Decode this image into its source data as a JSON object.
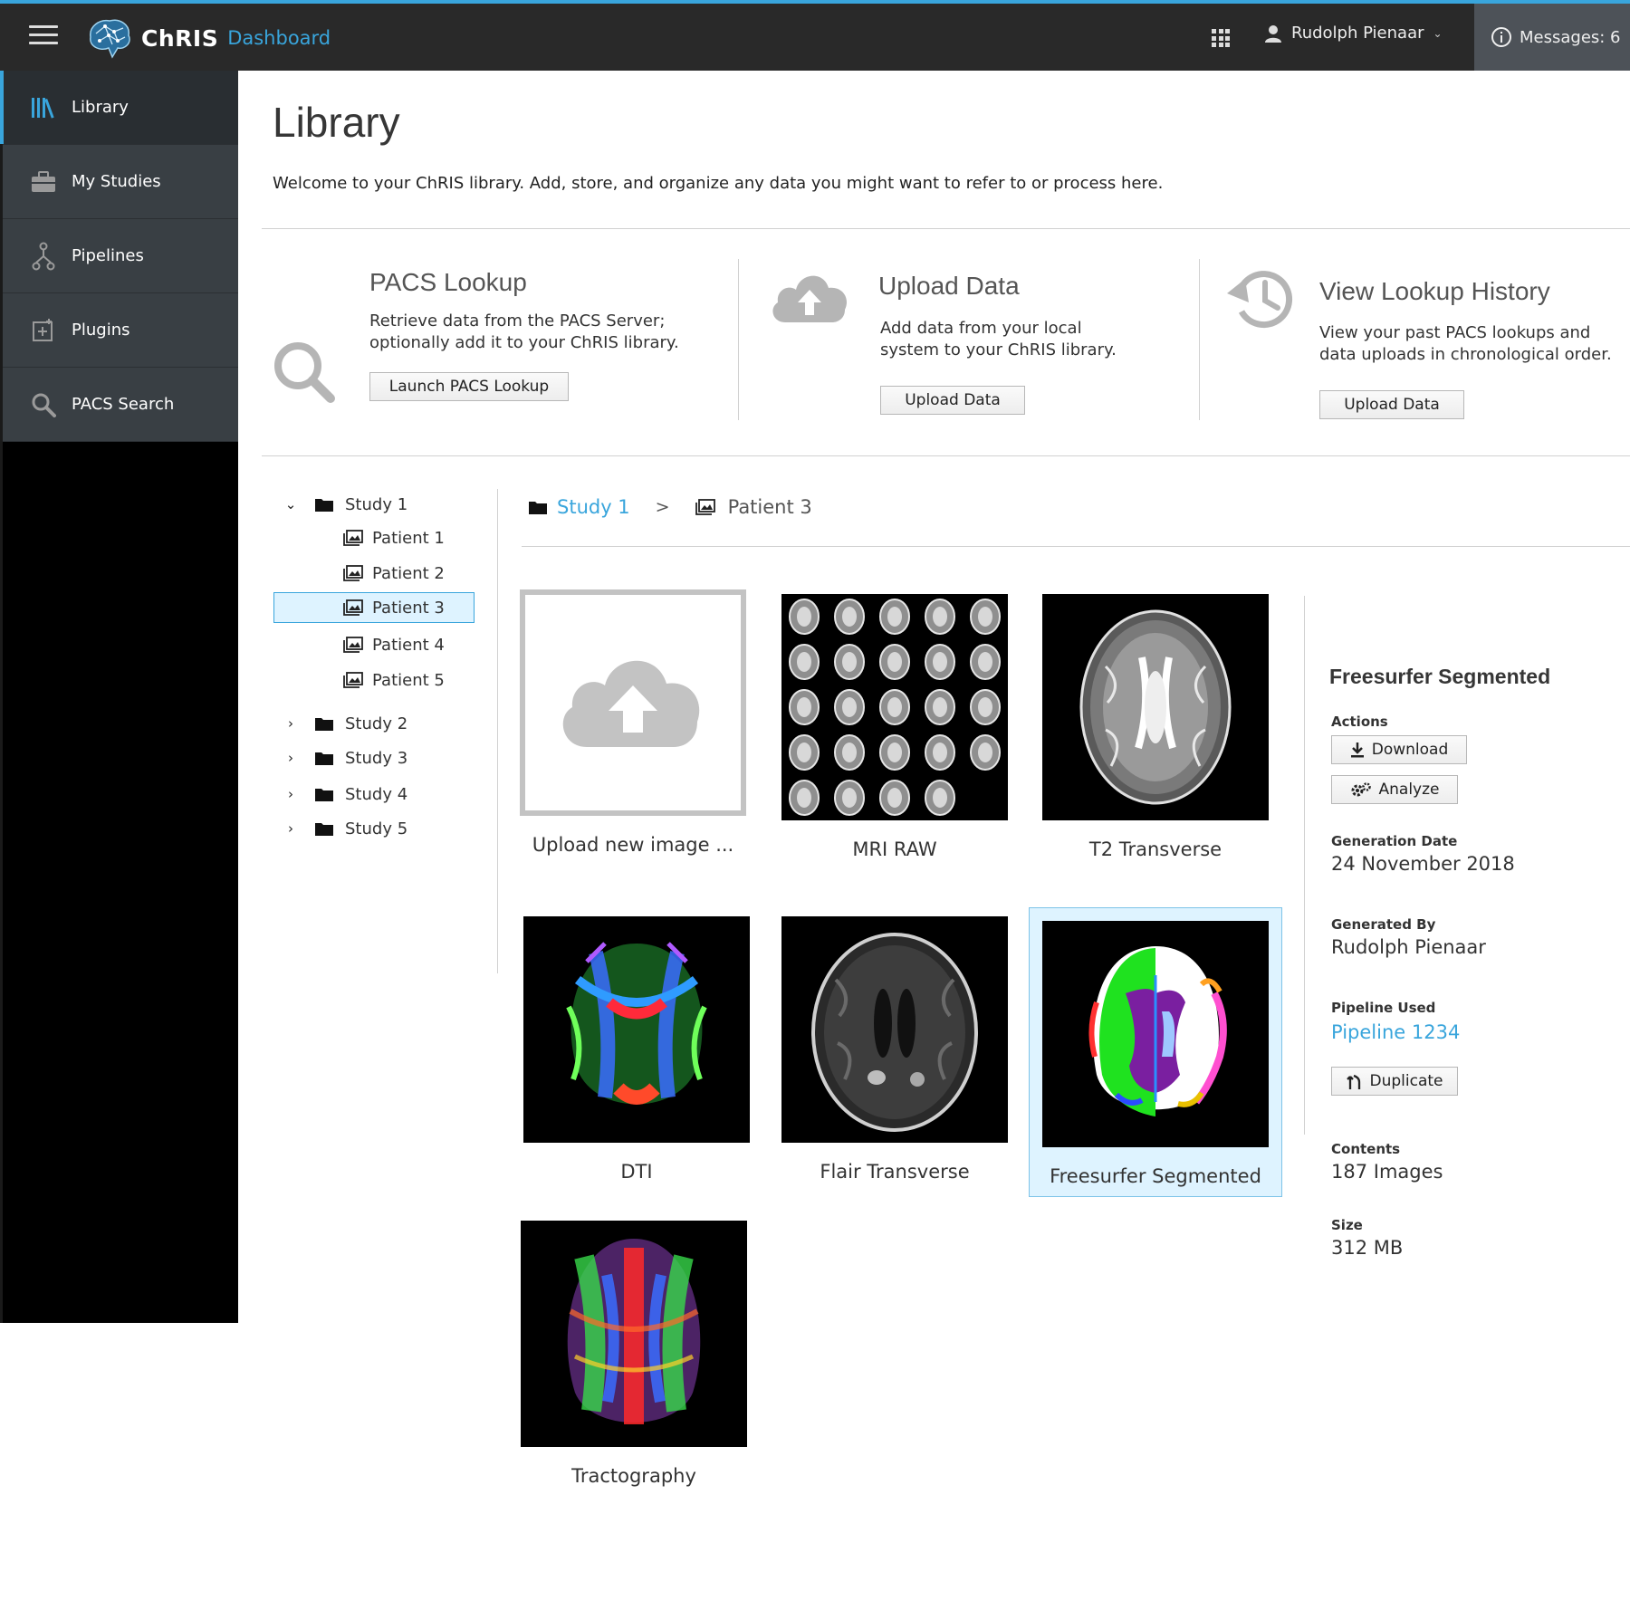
{
  "header": {
    "brand_name": "ChRIS",
    "brand_sub": "Dashboard",
    "user_name": "Rudolph Pienaar",
    "messages_label": "Messages: 6",
    "accent_color": "#39a5dc"
  },
  "sidebar": {
    "items": [
      {
        "label": "Library",
        "icon": "library-icon",
        "active": true
      },
      {
        "label": "My Studies",
        "icon": "briefcase-icon"
      },
      {
        "label": "Pipelines",
        "icon": "pipeline-icon"
      },
      {
        "label": "Plugins",
        "icon": "plugin-icon"
      },
      {
        "label": "PACS Search",
        "icon": "search-icon"
      }
    ]
  },
  "page": {
    "title": "Library",
    "welcome": "Welcome to your ChRIS library. Add, store, and organize any data you might want to refer to or process here."
  },
  "cards": [
    {
      "title": "PACS Lookup",
      "line1": "Retrieve data from the PACS Server;",
      "line2": "optionally add it to your ChRIS library.",
      "button": "Launch PACS Lookup",
      "icon": "search-icon"
    },
    {
      "title": "Upload Data",
      "line1": "Add data from your local",
      "line2": "system to your ChRIS library.",
      "button": "Upload Data",
      "icon": "cloud-upload-icon"
    },
    {
      "title": "View Lookup History",
      "line1": "View your past PACS lookups and",
      "line2": "data uploads in chronological order.",
      "button": "Upload Data",
      "icon": "history-icon"
    }
  ],
  "tree": {
    "studies": [
      {
        "label": "Study 1",
        "expanded": true,
        "patients": [
          "Patient 1",
          "Patient 2",
          "Patient 3",
          "Patient 4",
          "Patient 5"
        ],
        "selected_patient": "Patient 3"
      },
      {
        "label": "Study 2",
        "expanded": false
      },
      {
        "label": "Study 3",
        "expanded": false
      },
      {
        "label": "Study 4",
        "expanded": false
      },
      {
        "label": "Study 5",
        "expanded": false
      }
    ]
  },
  "breadcrumb": {
    "study": "Study 1",
    "separator": ">",
    "patient": "Patient 3"
  },
  "tiles": [
    {
      "caption": "Upload new image ..."
    },
    {
      "caption": "MRI RAW"
    },
    {
      "caption": "T2 Transverse"
    },
    {
      "caption": "DTI"
    },
    {
      "caption": "Flair Transverse"
    },
    {
      "caption": "Freesurfer Segmented",
      "selected": true
    },
    {
      "caption": "Tractography"
    }
  ],
  "details": {
    "title": "Freesurfer Segmented",
    "actions_label": "Actions",
    "download": "Download",
    "analyze": "Analyze",
    "generation_date_label": "Generation Date",
    "generation_date": "24 November 2018",
    "generated_by_label": "Generated By",
    "generated_by": "Rudolph Pienaar",
    "pipeline_label": "Pipeline Used",
    "pipeline": "Pipeline 1234",
    "duplicate": "Duplicate",
    "contents_label": "Contents",
    "contents": "187 Images",
    "size_label": "Size",
    "size": "312 MB"
  }
}
